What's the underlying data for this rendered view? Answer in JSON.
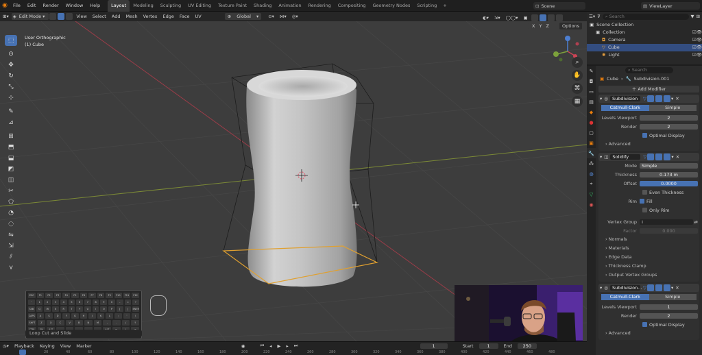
{
  "menu": [
    "File",
    "Edit",
    "Render",
    "Window",
    "Help"
  ],
  "workspaces": [
    {
      "label": "Layout",
      "active": true
    },
    {
      "label": "Modeling"
    },
    {
      "label": "Sculpting"
    },
    {
      "label": "UV Editing"
    },
    {
      "label": "Texture Paint"
    },
    {
      "label": "Shading"
    },
    {
      "label": "Animation"
    },
    {
      "label": "Rendering"
    },
    {
      "label": "Compositing"
    },
    {
      "label": "Geometry Nodes"
    },
    {
      "label": "Scripting"
    }
  ],
  "add_workspace": "+",
  "scene": "Scene",
  "view_layer": "ViewLayer",
  "editor_header": {
    "mode": "Edit Mode",
    "items": [
      "View",
      "Select",
      "Add",
      "Mesh",
      "Vertex",
      "Edge",
      "Face",
      "UV"
    ],
    "orientation": "Global",
    "options": "Options",
    "axes": [
      "X",
      "Y",
      "Z"
    ]
  },
  "viewport": {
    "view_name": "User Orthographic",
    "object_name": "(1) Cube",
    "nav": {
      "x": "X",
      "y": "Y",
      "z": "Z"
    }
  },
  "toolbar_icons": [
    "select-box-icon",
    "cursor-icon",
    "move-icon",
    "rotate-icon",
    "scale-icon",
    "transform-icon",
    "annotate-icon",
    "measure-icon",
    "add-cube-icon",
    "extrude-icon",
    "inset-icon",
    "bevel-icon",
    "loop-cut-icon",
    "knife-icon",
    "poly-build-icon",
    "spin-icon",
    "smooth-icon",
    "edge-slide-icon",
    "shrink-icon",
    "shear-icon",
    "rip-icon"
  ],
  "outliner": {
    "search_placeholder": "Search",
    "items": [
      {
        "label": "Scene Collection",
        "level": 0
      },
      {
        "label": "Collection",
        "level": 1
      },
      {
        "label": "Camera",
        "level": 2
      },
      {
        "label": "Cube",
        "level": 2,
        "selected": true
      },
      {
        "label": "Light",
        "level": 2
      }
    ]
  },
  "properties": {
    "search_placeholder": "Search",
    "breadcrumb_object": "Cube",
    "breadcrumb_modifier": "Subdivision.001",
    "add_modifier": "Add Modifier",
    "subdivision": {
      "name": "Subdivision",
      "modes": [
        "Catmull-Clark",
        "Simple"
      ],
      "levels_viewport_label": "Levels Viewport",
      "levels_viewport": "2",
      "render_label": "Render",
      "render": "2",
      "optimal_display": "Optimal Display",
      "advanced": "Advanced"
    },
    "solidify": {
      "name": "Solidify",
      "mode_label": "Mode",
      "mode": "Simple",
      "thickness_label": "Thickness",
      "thickness": "0.173 m",
      "offset_label": "Offset",
      "offset": "0.0000",
      "even_thickness": "Even Thickness",
      "rim_label": "Rim",
      "fill": "Fill",
      "only_rim": "Only Rim",
      "vertex_group_label": "Vertex Group",
      "factor_label": "Factor",
      "factor": "0.000",
      "subpanels": [
        "Normals",
        "Materials",
        "Edge Data",
        "Thickness Clamp",
        "Output Vertex Groups"
      ]
    },
    "subdivision2": {
      "name": "Subdivision...",
      "modes": [
        "Catmull-Clark",
        "Simple"
      ],
      "levels_viewport_label": "Levels Viewport",
      "levels_viewport": "1",
      "render_label": "Render",
      "render": "2",
      "optimal_display": "Optimal Display",
      "advanced": "Advanced"
    }
  },
  "keyboard": {
    "rows": [
      [
        "ESC",
        "F1",
        "F2",
        "F3",
        "F4",
        "F5",
        "F6",
        "F7",
        "F8",
        "F9",
        "F10",
        "F11",
        "F12"
      ],
      [
        "`",
        "1",
        "2",
        "3",
        "4",
        "5",
        "6",
        "7",
        "8",
        "9",
        "0",
        "-",
        "=",
        "←"
      ],
      [
        "TAB",
        "Q",
        "W",
        "E",
        "R",
        "T",
        "Y",
        "U",
        "I",
        "O",
        "P",
        "[",
        "]",
        "ENTR"
      ],
      [
        "CAPS",
        "A",
        "S",
        "D",
        "F",
        "G",
        "H",
        "J",
        "K",
        "L",
        ";",
        "'",
        "\\"
      ],
      [
        "SHFT",
        "Z",
        "X",
        "C",
        "V",
        "B",
        "N",
        "M",
        ",",
        ".",
        "/",
        "↑"
      ],
      [
        "CTRL",
        "FN",
        "ALT",
        "",
        "",
        "",
        "",
        "",
        "ALT",
        "←",
        "↓",
        "→"
      ]
    ]
  },
  "status_hint": "Loop Cut and Slide",
  "timeline": {
    "playback": "Playback",
    "keying": "Keying",
    "view": "View",
    "marker": "Marker",
    "current_frame": "1",
    "start_label": "Start",
    "start": "1",
    "end_label": "End",
    "end": "250",
    "ruler": [
      "20",
      "40",
      "60",
      "80",
      "100",
      "120",
      "140",
      "160",
      "180",
      "200",
      "220",
      "240",
      "260",
      "280",
      "300",
      "320",
      "340",
      "360",
      "380",
      "400",
      "420",
      "440",
      "460",
      "480"
    ]
  },
  "colors": {
    "accent": "#4772b3",
    "viewport_bg": "#3d3d3d",
    "selected_edge": "#e0a030"
  }
}
